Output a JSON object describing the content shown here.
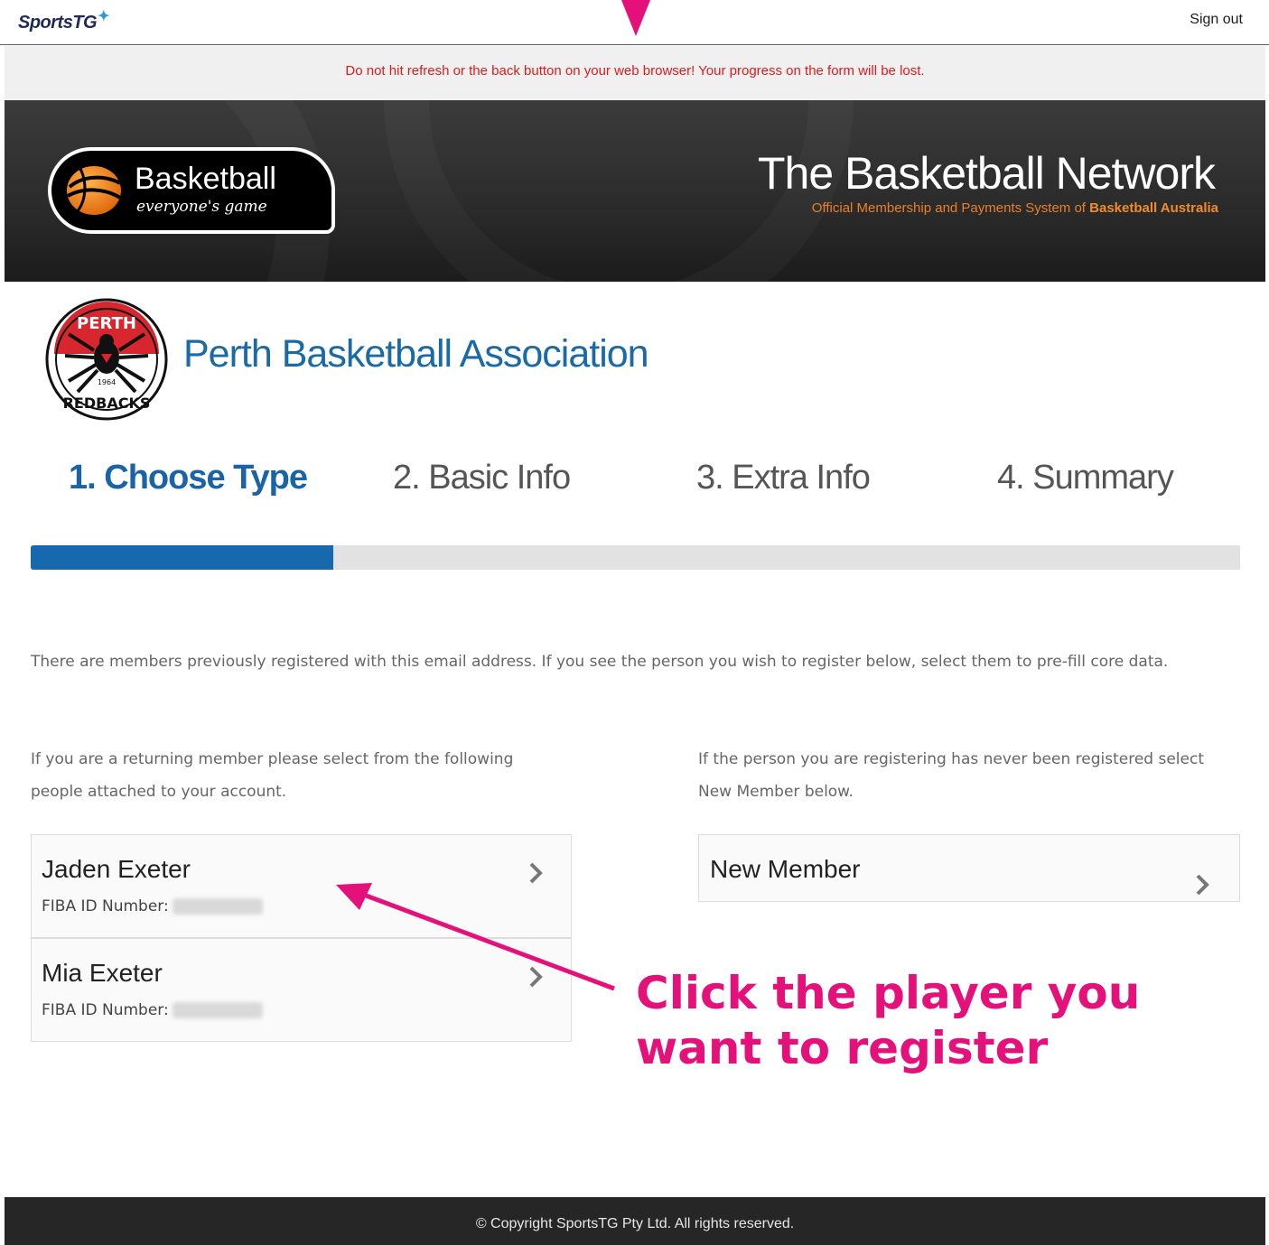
{
  "header": {
    "brand": "SportsTG",
    "signout_label": "Sign out"
  },
  "warning": "Do not hit refresh or the back button on your web browser! Your progress on the form will be lost.",
  "banner": {
    "logo_word": "Basketball",
    "logo_tagline": "everyone's game",
    "title": "The Basketball Network",
    "subtitle_prefix": "Official Membership and Payments System of ",
    "subtitle_bold": "Basketball Australia"
  },
  "association": {
    "name": "Perth Basketball Association",
    "logo_top_text": "PERTH",
    "logo_bottom_text": "REDBACKS",
    "logo_year": "1964"
  },
  "steps": [
    {
      "label": "1. Choose Type",
      "active": true
    },
    {
      "label": "2. Basic Info",
      "active": false
    },
    {
      "label": "3. Extra Info",
      "active": false
    },
    {
      "label": "4. Summary",
      "active": false
    }
  ],
  "progress_fraction": 0.25,
  "intro": "There are members previously registered with this email address. If you see the person you wish to register below, select them to pre-fill core data.",
  "returning_text": "If you are a returning member please select from the following people attached to your account.",
  "new_text": "If the person you are registering has never been registered select New Member below.",
  "members": [
    {
      "name": "Jaden Exeter",
      "fiba_label": "FIBA ID Number:"
    },
    {
      "name": "Mia Exeter",
      "fiba_label": "FIBA ID Number:"
    }
  ],
  "new_member_label": "New Member",
  "annotation": {
    "line1": "Click the player you",
    "line2": "want to register",
    "color": "#e5117b"
  },
  "footer": "©  Copyright SportsTG Pty Ltd. All rights reserved.",
  "colors": {
    "accent": "#1769ad",
    "warning": "#e01b1b",
    "banner_orange": "#e8802a"
  }
}
